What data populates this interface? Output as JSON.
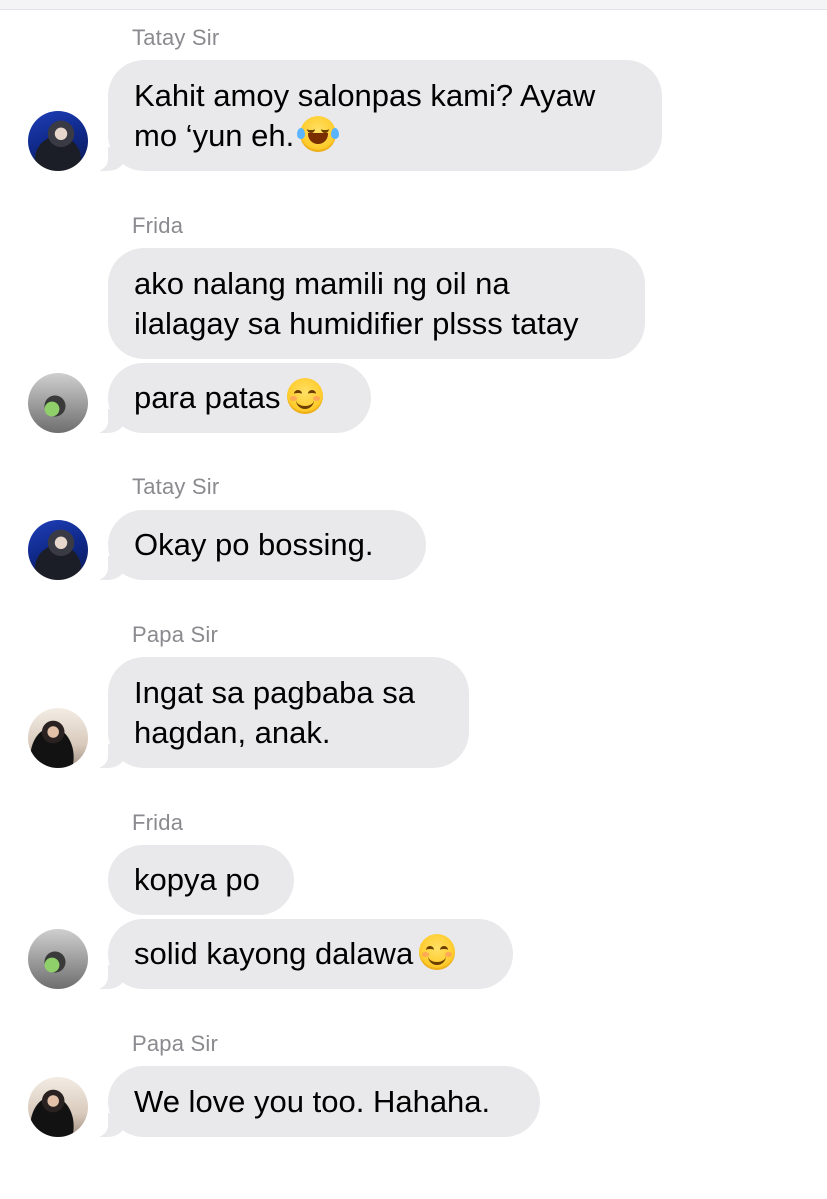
{
  "messages": [
    {
      "sender": "Tatay Sir",
      "avatar_icon": "tatay-avatar",
      "bubbles": [
        {
          "lines": [
            "Kahit amoy salonpas kami? Ayaw",
            "mo ‘yun eh."
          ],
          "emoji": "face-with-tears-of-joy"
        }
      ]
    },
    {
      "sender": "Frida",
      "avatar_icon": "frida-avatar",
      "bubbles": [
        {
          "lines": [
            "ako nalang mamili ng oil na",
            "ilalagay sa humidifier plsss tatay"
          ]
        },
        {
          "lines": [
            "para patas"
          ],
          "emoji": "smiling-face-with-smiling-eyes"
        }
      ]
    },
    {
      "sender": "Tatay Sir",
      "avatar_icon": "tatay-avatar",
      "bubbles": [
        {
          "lines": [
            "Okay po bossing."
          ]
        }
      ]
    },
    {
      "sender": "Papa Sir",
      "avatar_icon": "papa-avatar",
      "bubbles": [
        {
          "lines": [
            "Ingat sa pagbaba sa",
            "hagdan, anak."
          ]
        }
      ]
    },
    {
      "sender": "Frida",
      "avatar_icon": "frida-avatar",
      "bubbles": [
        {
          "lines": [
            "kopya po"
          ]
        },
        {
          "lines": [
            "solid kayong dalawa"
          ],
          "emoji": "smiling-face-with-smiling-eyes"
        }
      ]
    },
    {
      "sender": "Papa Sir",
      "avatar_icon": "papa-avatar",
      "bubbles": [
        {
          "lines": [
            "We love you too. Hahaha."
          ]
        }
      ]
    }
  ],
  "colors": {
    "incoming_bubble": "#e9e9eb",
    "sender_name": "#8a8a8f",
    "background": "#ffffff"
  }
}
